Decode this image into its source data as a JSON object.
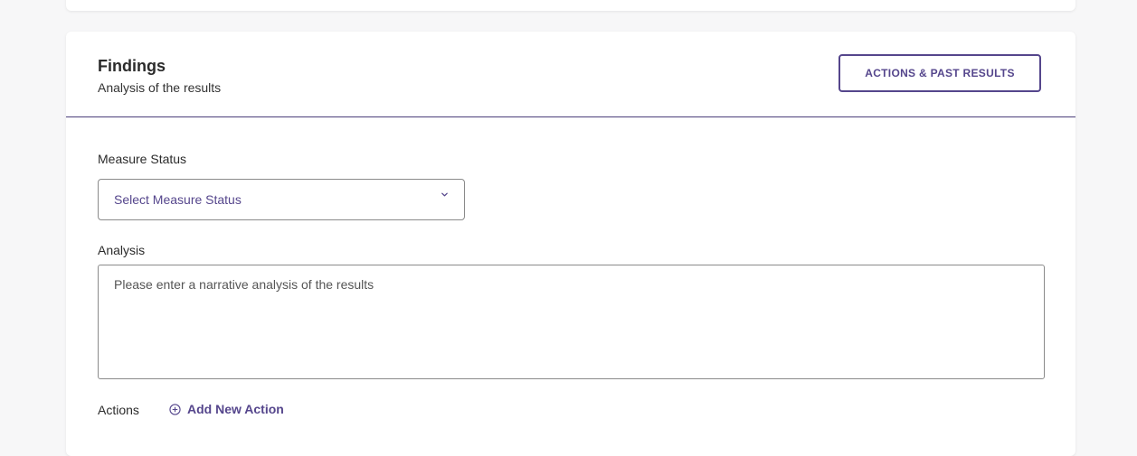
{
  "findings": {
    "title": "Findings",
    "subtitle": "Analysis of the results",
    "actions_past_results_label": "ACTIONS & PAST RESULTS"
  },
  "measure_status": {
    "label": "Measure Status",
    "selected": "Select Measure Status",
    "icon": "chevron-down-icon"
  },
  "analysis": {
    "label": "Analysis",
    "value": "",
    "placeholder": "Please enter a narrative analysis of the results"
  },
  "actions": {
    "label": "Actions",
    "add_label": "Add New Action",
    "add_icon": "plus-circle-icon"
  },
  "colors": {
    "accent": "#55468c",
    "divider": "#4b3f7a",
    "background": "#f7f7f8",
    "card": "#ffffff"
  }
}
